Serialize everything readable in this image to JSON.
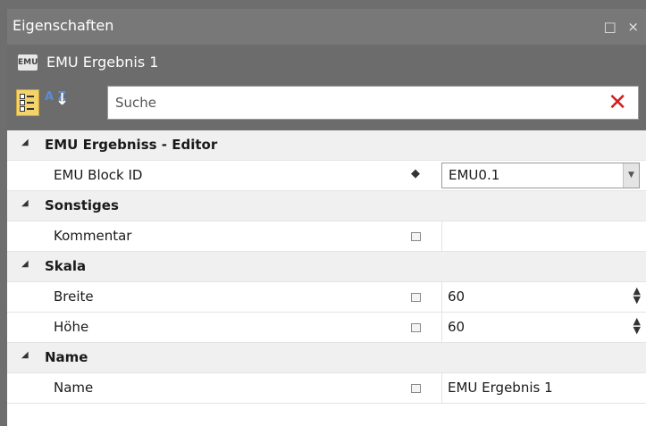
{
  "panel": {
    "title": "Eigenschaften",
    "window_buttons": "□ ×"
  },
  "object": {
    "icon_text": "EMU",
    "name": "EMU Ergebnis 1"
  },
  "toolbar": {
    "categorized_icon": "categorized-icon",
    "alpha_label": "A Z",
    "search_placeholder": "Suche",
    "clear_glyph": "✕"
  },
  "categories": [
    {
      "label": "EMU Ergebniss - Editor",
      "props": [
        {
          "label": "EMU Block ID",
          "value": "EMU0.1",
          "editor": "combo"
        }
      ]
    },
    {
      "label": "Sonstiges",
      "props": [
        {
          "label": "Kommentar",
          "value": ""
        }
      ]
    },
    {
      "label": "Skala",
      "props": [
        {
          "label": "Breite",
          "value": "60",
          "editor": "spin"
        },
        {
          "label": "Höhe",
          "value": "60",
          "editor": "spin"
        }
      ]
    },
    {
      "label": "Name",
      "props": [
        {
          "label": "Name",
          "value": "EMU Ergebnis 1"
        }
      ]
    }
  ],
  "glyphs": {
    "expand": "◢",
    "diamond": "◆",
    "dropdown": "▼",
    "spin": "▲▼"
  }
}
